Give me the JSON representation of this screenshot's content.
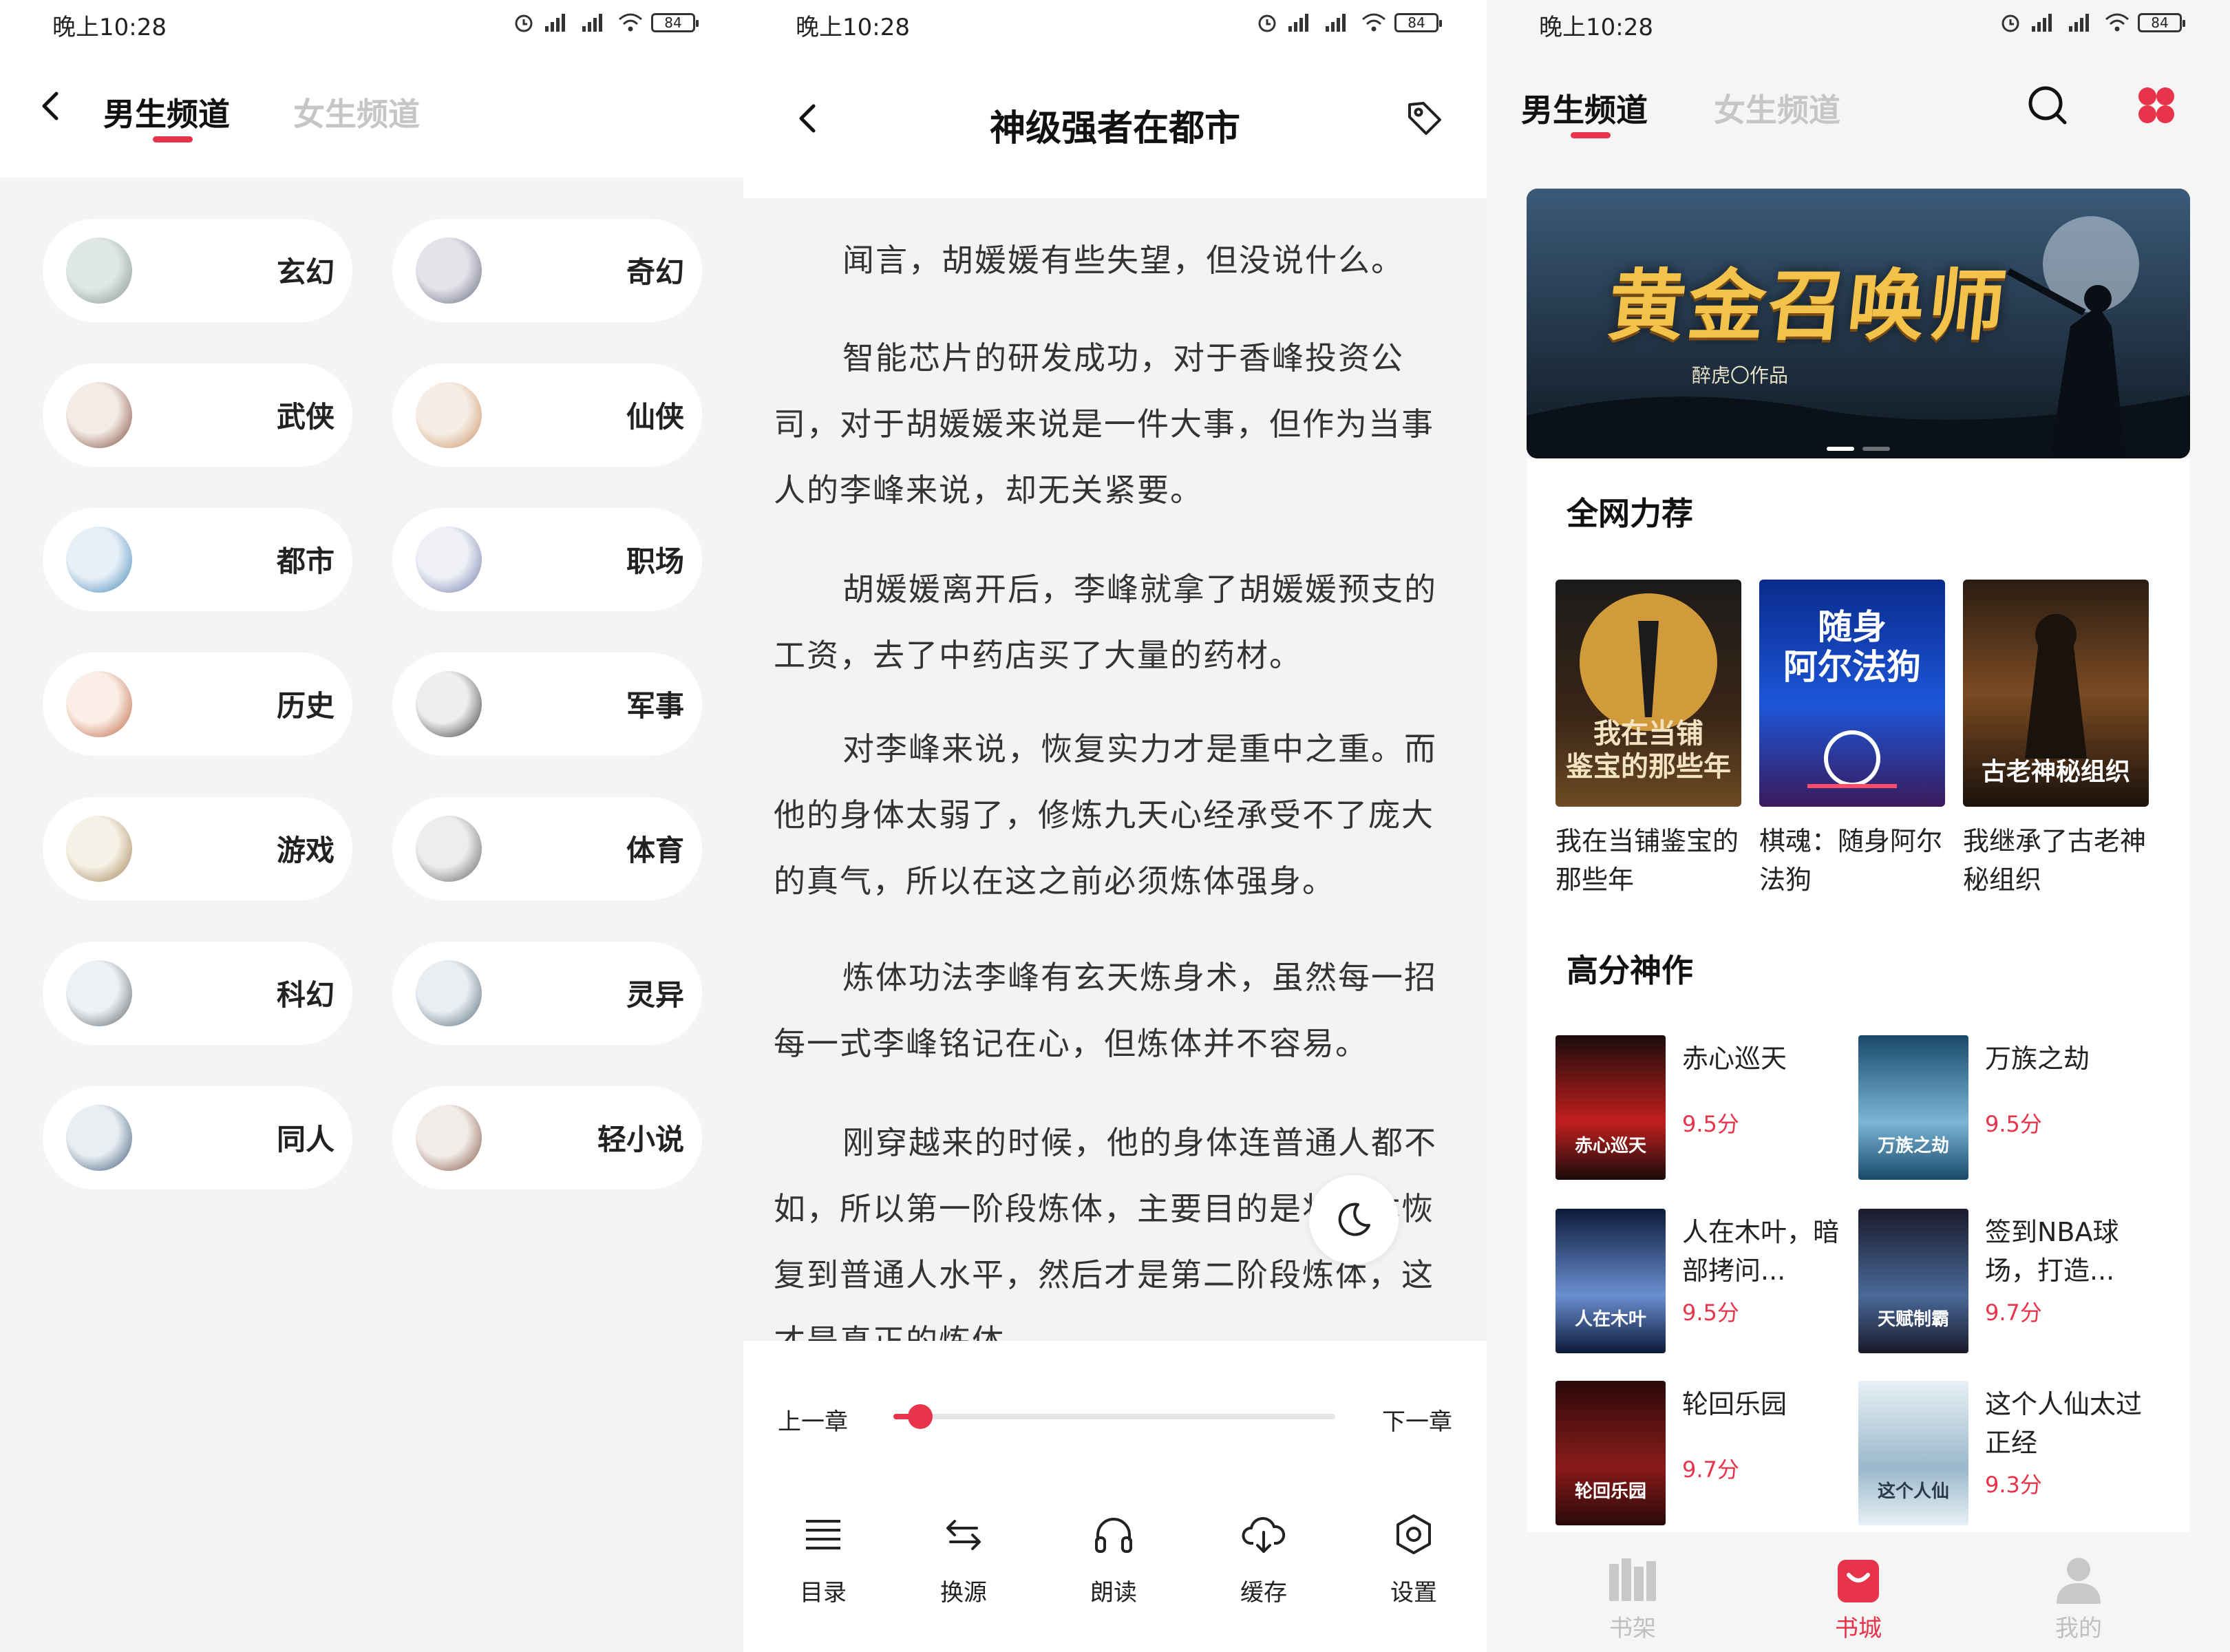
{
  "status_bar": {
    "time": "晚上10:28",
    "battery": "84"
  },
  "colors": {
    "accent": "#e8344a",
    "inactive": "#c6c6c6"
  },
  "category_screen": {
    "tabs": [
      "男生频道",
      "女生频道"
    ],
    "categories": [
      {
        "label": "玄幻"
      },
      {
        "label": "奇幻"
      },
      {
        "label": "武侠"
      },
      {
        "label": "仙侠"
      },
      {
        "label": "都市"
      },
      {
        "label": "职场"
      },
      {
        "label": "历史"
      },
      {
        "label": "军事"
      },
      {
        "label": "游戏"
      },
      {
        "label": "体育"
      },
      {
        "label": "科幻"
      },
      {
        "label": "灵异"
      },
      {
        "label": "同人"
      },
      {
        "label": "轻小说"
      }
    ]
  },
  "reader_screen": {
    "title": "神级强者在都市",
    "paragraphs": [
      "闻言，胡媛媛有些失望，但没说什么。",
      "智能芯片的研发成功，对于香峰投资公司，对于胡媛媛来说是一件大事，但作为当事人的李峰来说，却无关紧要。",
      "胡媛媛离开后，李峰就拿了胡媛媛预支的工资，去了中药店买了大量的药材。",
      "对李峰来说，恢复实力才是重中之重。而他的身体太弱了，修炼九天心经承受不了庞大的真气，所以在这之前必须炼体强身。",
      "炼体功法李峰有玄天炼身术，虽然每一招每一式李峰铭记在心，但炼体并不容易。",
      "刚穿越来的时候，他的身体连普通人都不如，所以第一阶段炼体，主要目的是将身体恢复到普通人水平，然后才是第二阶段炼体，这才是真正的炼体。"
    ],
    "prev_chapter": "上一章",
    "next_chapter": "下一章",
    "progress": 0.06,
    "tools": [
      {
        "label": "目录",
        "icon": "list-icon"
      },
      {
        "label": "换源",
        "icon": "swap-icon"
      },
      {
        "label": "朗读",
        "icon": "headphones-icon"
      },
      {
        "label": "缓存",
        "icon": "cloud-download-icon"
      },
      {
        "label": "设置",
        "icon": "settings-hexagon-icon"
      }
    ]
  },
  "store_screen": {
    "tabs": [
      "男生频道",
      "女生频道"
    ],
    "banner": {
      "title": "黄金召唤师",
      "subtitle": "醉虎〇作品"
    },
    "recommend": {
      "title": "全网力荐",
      "books": [
        {
          "title": "我在当铺鉴宝的那些年",
          "cover_text": "我在当铺\n鉴宝的那些年"
        },
        {
          "title": "棋魂：随身阿尔法狗",
          "cover_text": "随身\n阿尔法狗"
        },
        {
          "title": "我继承了古老神秘组织",
          "cover_text": "古老神秘组织"
        }
      ]
    },
    "high_score": {
      "title": "高分神作",
      "books": [
        {
          "title": "赤心巡天",
          "score": "9.5分",
          "cover_text": "赤心巡天"
        },
        {
          "title": "万族之劫",
          "score": "9.5分",
          "cover_text": "万族之劫"
        },
        {
          "title": "人在木叶，暗部拷问...",
          "score": "9.5分",
          "cover_text": "人在木叶"
        },
        {
          "title": "签到NBA球场，打造...",
          "score": "9.7分",
          "cover_text": "天赋制霸"
        },
        {
          "title": "轮回乐园",
          "score": "9.7分",
          "cover_text": "轮回乐园"
        },
        {
          "title": "这个人仙太过正经",
          "score": "9.3分",
          "cover_text": "这个人仙"
        }
      ]
    },
    "bottom_nav": [
      {
        "label": "书架",
        "icon": "bookshelf-icon",
        "active": false
      },
      {
        "label": "书城",
        "icon": "shopping-bag-icon",
        "active": true
      },
      {
        "label": "我的",
        "icon": "user-icon",
        "active": false
      }
    ]
  }
}
